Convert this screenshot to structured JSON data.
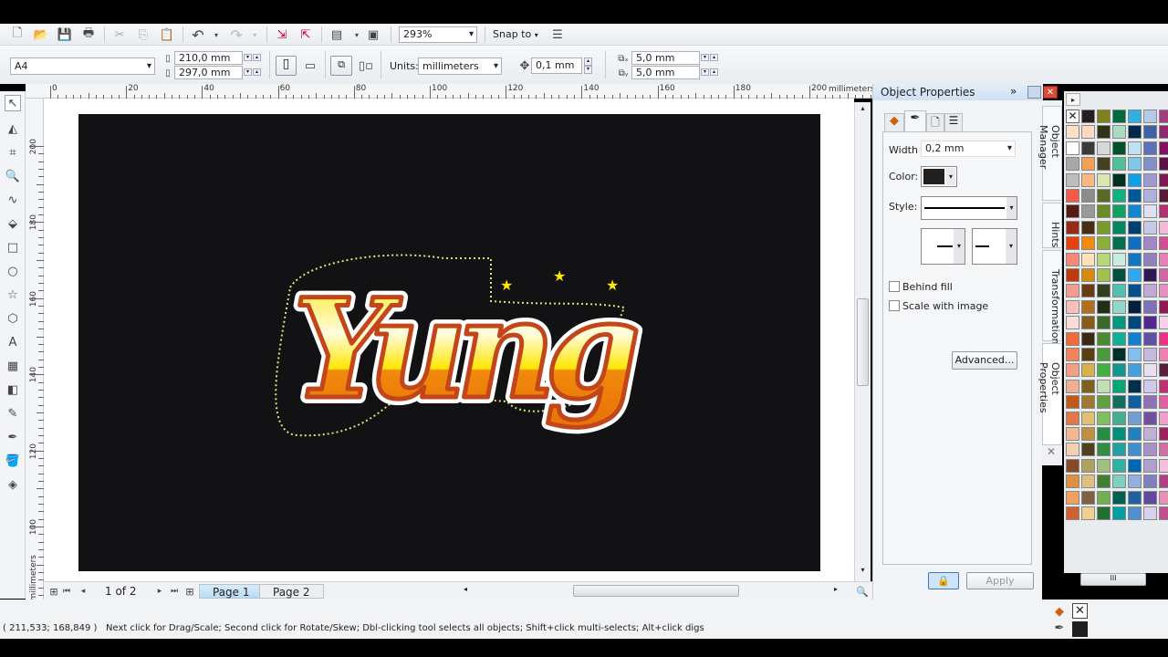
{
  "toolbar": {
    "zoom": "293%",
    "snap_to": "Snap to",
    "icons": [
      "new-icon",
      "open-icon",
      "save-icon",
      "print-icon",
      "cut-icon",
      "copy-icon",
      "paste-icon",
      "undo-icon",
      "redo-icon",
      "import-icon",
      "export-icon",
      "application-launcher-icon",
      "welcome-screen-icon"
    ]
  },
  "property_bar": {
    "page_size": "A4",
    "width": "210,0 mm",
    "height": "297,0 mm",
    "units_label": "Units:",
    "units": "millimeters",
    "nudge": "0,1 mm",
    "dup_x": "5,0 mm",
    "dup_y": "5,0 mm"
  },
  "ruler": {
    "top_labels": [
      "0",
      "20",
      "40",
      "60",
      "80",
      "100",
      "120",
      "140",
      "160",
      "180",
      "200"
    ],
    "unit": "millimeters",
    "left_labels": [
      "200",
      "180",
      "160",
      "140",
      "120",
      "100"
    ],
    "left_unit": "millimeters"
  },
  "artwork": {
    "text": "Yung",
    "colors": {
      "yellow": "#ffe600",
      "orange": "#f08a0c",
      "brown": "#c2461a",
      "page": "#121214"
    }
  },
  "navigation": {
    "page_count": "1 of 2",
    "pages": [
      "Page 1",
      "Page 2"
    ]
  },
  "docker": {
    "title": "Object Properties",
    "width_label": "Width",
    "width": "0,2 mm",
    "color_label": "Color:",
    "color": "#231f1c",
    "style_label": "Style:",
    "behind_fill": "Behind fill",
    "scale_with_image": "Scale with image",
    "advanced": "Advanced...",
    "apply": "Apply",
    "tabs": [
      "Object Manager",
      "Hints",
      "Transformation",
      "Object Properties"
    ]
  },
  "status": {
    "coords": "( 211,533; 168,849 )",
    "message": "Next click for Drag/Scale; Second click for Rotate/Skew; Dbl-clicking tool selects all objects; Shift+click multi-selects; Alt+click digs"
  },
  "palette": [
    [
      "#ffffff",
      "#ffe0c8",
      "#ffffff",
      "#a8a8a8",
      "#bdbdbd",
      "#f25a4a",
      "#5a1a14",
      "#9a2a14",
      "#e84010",
      "#f4867a",
      "#c03a10",
      "#f49a90",
      "#f8c0b8",
      "#fcdcd8",
      "#f06a3a",
      "#f4825a",
      "#f4a080",
      "#f0b090",
      "#c05a1a",
      "#e0784a",
      "#f4b890",
      "#f4d0b0",
      "#8a4a2a",
      "#e09040",
      "#f0a060",
      "#d06030"
    ],
    [
      "#231f20",
      "#ffd9c0",
      "#3a3a3a",
      "#f4a050",
      "#f8b880",
      "#8c8c8c",
      "#9a9a9a",
      "#4a2e14",
      "#f48a0a",
      "#ffe0b8",
      "#d88a10",
      "#6a3a14",
      "#b07020",
      "#8a5a1a",
      "#3a2a14",
      "#5a4010",
      "#d8b050",
      "#806020",
      "#a07830",
      "#e0c070",
      "#c09040",
      "#504020",
      "#b0a060",
      "#e0c080",
      "#806040",
      "#f0d090"
    ],
    [
      "#808020",
      "#323218",
      "#d8d8d8",
      "#464020",
      "#d8e8b0",
      "#5a6a24",
      "#6a8a24",
      "#7a9a2a",
      "#8ab03a",
      "#b8d878",
      "#a0c050",
      "#30401e",
      "#203018",
      "#3a6a2a",
      "#4a8a30",
      "#4a9a3a",
      "#40b040",
      "#c0e0b0",
      "#60a040",
      "#80c060",
      "#209040",
      "#309040",
      "#a0c080",
      "#408030",
      "#70b050",
      "#207030"
    ],
    [
      "#006a3a",
      "#a8dcc0",
      "#00502a",
      "#50c098",
      "#003020",
      "#10b080",
      "#10a060",
      "#008860",
      "#007050",
      "#c8ece0",
      "#005040",
      "#50c0b0",
      "#90d8c8",
      "#009880",
      "#10b098",
      "#003028",
      "#109890",
      "#00a878",
      "#107060",
      "#40b090",
      "#00907a",
      "#20a0a0",
      "#30b0a0",
      "#80d0c0",
      "#006050",
      "#00a0a0"
    ],
    [
      "#30b0e0",
      "#002848",
      "#c0e0f4",
      "#80c8e8",
      "#10a0e8",
      "#005898",
      "#1088d0",
      "#004070",
      "#1070c0",
      "#1078c0",
      "#30a8f0",
      "#005090",
      "#002040",
      "#004880",
      "#1080d0",
      "#80c0f0",
      "#40a0e0",
      "#003050",
      "#1060a0",
      "#70a0d0",
      "#2080c0",
      "#4090d0",
      "#0068b0",
      "#90b0e0",
      "#2060a0",
      "#5090d0"
    ],
    [
      "#b8c8e8",
      "#4060a8",
      "#6070b8",
      "#8090c8",
      "#a098d0",
      "#b0b0e0",
      "#e0e0f4",
      "#c8c8e8",
      "#a088c8",
      "#9080c0",
      "#301858",
      "#c0a8d8",
      "#8070b8",
      "#502890",
      "#6050a8",
      "#c8b8e0",
      "#e8e0f0",
      "#d0c8e8",
      "#9070b8",
      "#7050a0",
      "#c0b0d8",
      "#a890c8",
      "#b0a0d0",
      "#8080c0",
      "#6048a0",
      "#d8d0ec"
    ],
    [
      "#a04080",
      "#902870",
      "#801060",
      "#601048",
      "#801850",
      "#5a1838",
      "#b03070",
      "#f4b8d8",
      "#d05090",
      "#e880b8",
      "#d068a8",
      "#e890c0",
      "#901850",
      "#f8d0e8",
      "#f03080",
      "#f080b0",
      "#582038",
      "#c03070",
      "#e060a0",
      "#f0a0c8",
      "#a02060",
      "#d070a0",
      "#f4c0dc",
      "#b04080",
      "#e890b8",
      "#c05090"
    ]
  ]
}
